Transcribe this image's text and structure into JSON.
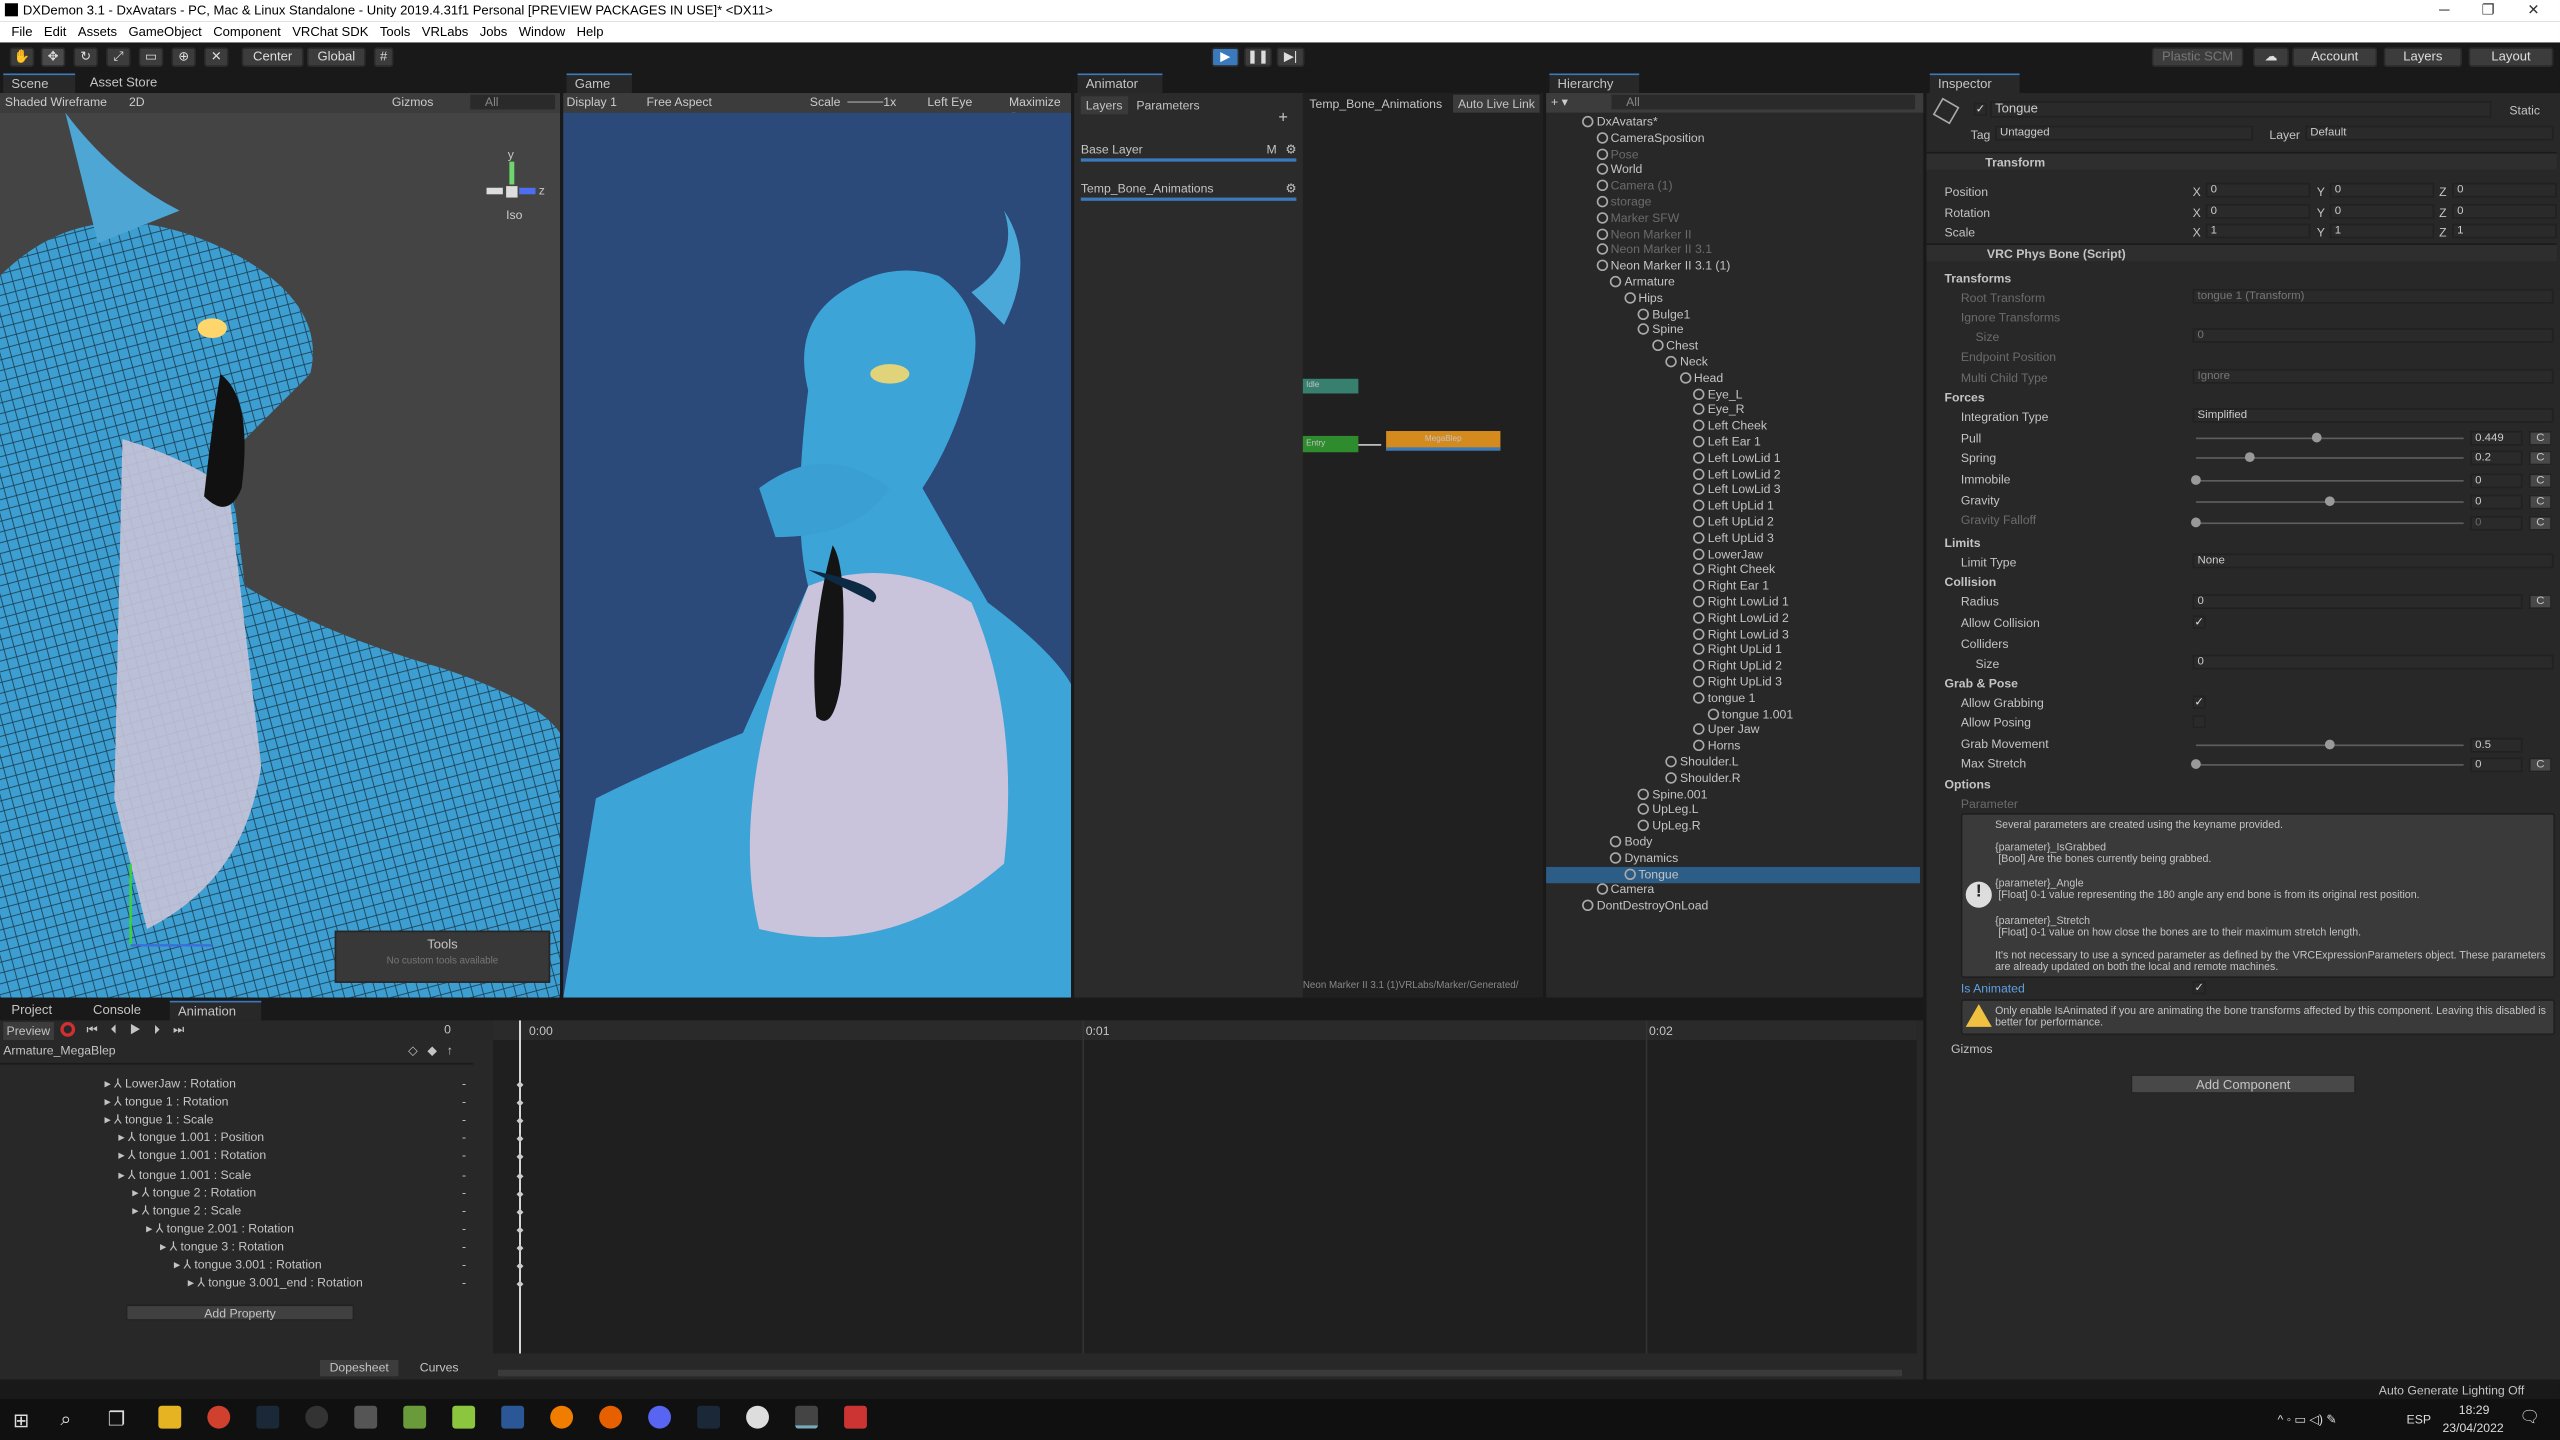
{
  "window": {
    "title": "DXDemon 3.1 - DxAvatars - PC, Mac & Linux Standalone - Unity 2019.4.31f1 Personal [PREVIEW PACKAGES IN USE]* <DX11>",
    "minimize": "─",
    "maximize": "❐",
    "close": "✕"
  },
  "menu": [
    "File",
    "Edit",
    "Assets",
    "GameObject",
    "Component",
    "VRChat SDK",
    "Tools",
    "VRLabs",
    "Jobs",
    "Window",
    "Help"
  ],
  "toolbar": {
    "center": "Center",
    "global": "Global",
    "plastic": "Plastic SCM",
    "account": "Account",
    "layers": "Layers",
    "layout": "Layout"
  },
  "scene": {
    "tab_scene": "Scene",
    "tab_asset_store": "Asset Store",
    "shading": "Shaded Wireframe",
    "mode2d": "2D",
    "gizmos": "Gizmos",
    "search": "All",
    "iso": "Iso",
    "tools_title": "Tools",
    "tools_msg": "No custom tools available",
    "persp_y": "y",
    "persp_z": "z"
  },
  "game": {
    "tab": "Game",
    "display": "Display 1",
    "aspect": "Free Aspect",
    "scale": "Scale",
    "scale_val": "1x",
    "eye": "Left Eye",
    "maximize": "Maximize O"
  },
  "animator": {
    "tab": "Animator",
    "layers": "Layers",
    "parameters": "Parameters",
    "breadcrumb": "Temp_Bone_Animations",
    "auto_live": "Auto Live Link",
    "base_layer": "Base Layer",
    "base_m": "M",
    "layer2": "Temp_Bone_Animations",
    "state_entry": "Entry",
    "state_idle": "Idle",
    "state_mega": "MegaBlep",
    "path": "Neon Marker II 3.1 (1)VRLabs/Marker/Generated/"
  },
  "hierarchy": {
    "tab": "Hierarchy",
    "search": "All",
    "items": [
      {
        "label": "DxAvatars*",
        "depth": 0,
        "dim": false,
        "sel": false
      },
      {
        "label": "CameraSposition",
        "depth": 1,
        "dim": false,
        "sel": false
      },
      {
        "label": "Pose",
        "depth": 1,
        "dim": true,
        "sel": false
      },
      {
        "label": "World",
        "depth": 1,
        "dim": false,
        "sel": false
      },
      {
        "label": "Camera (1)",
        "depth": 1,
        "dim": true,
        "sel": false
      },
      {
        "label": "storage",
        "depth": 1,
        "dim": true,
        "sel": false
      },
      {
        "label": "Marker SFW",
        "depth": 1,
        "dim": true,
        "sel": false
      },
      {
        "label": "Neon Marker II",
        "depth": 1,
        "dim": true,
        "sel": false
      },
      {
        "label": "Neon Marker II 3.1",
        "depth": 1,
        "dim": true,
        "sel": false
      },
      {
        "label": "Neon Marker II 3.1 (1)",
        "depth": 1,
        "dim": false,
        "sel": false
      },
      {
        "label": "Armature",
        "depth": 2,
        "dim": false,
        "sel": false
      },
      {
        "label": "Hips",
        "depth": 3,
        "dim": false,
        "sel": false
      },
      {
        "label": "Bulge1",
        "depth": 4,
        "dim": false,
        "sel": false
      },
      {
        "label": "Spine",
        "depth": 4,
        "dim": false,
        "sel": false
      },
      {
        "label": "Chest",
        "depth": 5,
        "dim": false,
        "sel": false
      },
      {
        "label": "Neck",
        "depth": 6,
        "dim": false,
        "sel": false
      },
      {
        "label": "Head",
        "depth": 7,
        "dim": false,
        "sel": false
      },
      {
        "label": "Eye_L",
        "depth": 8,
        "dim": false,
        "sel": false
      },
      {
        "label": "Eye_R",
        "depth": 8,
        "dim": false,
        "sel": false
      },
      {
        "label": "Left Cheek",
        "depth": 8,
        "dim": false,
        "sel": false
      },
      {
        "label": "Left Ear 1",
        "depth": 8,
        "dim": false,
        "sel": false
      },
      {
        "label": "Left LowLid 1",
        "depth": 8,
        "dim": false,
        "sel": false
      },
      {
        "label": "Left LowLid 2",
        "depth": 8,
        "dim": false,
        "sel": false
      },
      {
        "label": "Left LowLid 3",
        "depth": 8,
        "dim": false,
        "sel": false
      },
      {
        "label": "Left UpLid 1",
        "depth": 8,
        "dim": false,
        "sel": false
      },
      {
        "label": "Left UpLid 2",
        "depth": 8,
        "dim": false,
        "sel": false
      },
      {
        "label": "Left UpLid 3",
        "depth": 8,
        "dim": false,
        "sel": false
      },
      {
        "label": "LowerJaw",
        "depth": 8,
        "dim": false,
        "sel": false
      },
      {
        "label": "Right Cheek",
        "depth": 8,
        "dim": false,
        "sel": false
      },
      {
        "label": "Right Ear 1",
        "depth": 8,
        "dim": false,
        "sel": false
      },
      {
        "label": "Right LowLid 1",
        "depth": 8,
        "dim": false,
        "sel": false
      },
      {
        "label": "Right LowLid 2",
        "depth": 8,
        "dim": false,
        "sel": false
      },
      {
        "label": "Right LowLid 3",
        "depth": 8,
        "dim": false,
        "sel": false
      },
      {
        "label": "Right UpLid 1",
        "depth": 8,
        "dim": false,
        "sel": false
      },
      {
        "label": "Right UpLid 2",
        "depth": 8,
        "dim": false,
        "sel": false
      },
      {
        "label": "Right UpLid 3",
        "depth": 8,
        "dim": false,
        "sel": false
      },
      {
        "label": "tongue 1",
        "depth": 8,
        "dim": false,
        "sel": false
      },
      {
        "label": "tongue 1.001",
        "depth": 9,
        "dim": false,
        "sel": false
      },
      {
        "label": "Uper Jaw",
        "depth": 8,
        "dim": false,
        "sel": false
      },
      {
        "label": "Horns",
        "depth": 8,
        "dim": false,
        "sel": false
      },
      {
        "label": "Shoulder.L",
        "depth": 6,
        "dim": false,
        "sel": false
      },
      {
        "label": "Shoulder.R",
        "depth": 6,
        "dim": false,
        "sel": false
      },
      {
        "label": "Spine.001",
        "depth": 4,
        "dim": false,
        "sel": false
      },
      {
        "label": "UpLeg.L",
        "depth": 4,
        "dim": false,
        "sel": false
      },
      {
        "label": "UpLeg.R",
        "depth": 4,
        "dim": false,
        "sel": false
      },
      {
        "label": "Body",
        "depth": 2,
        "dim": false,
        "sel": false
      },
      {
        "label": "Dynamics",
        "depth": 2,
        "dim": false,
        "sel": false
      },
      {
        "label": "Tongue",
        "depth": 3,
        "dim": false,
        "sel": true
      },
      {
        "label": "Camera",
        "depth": 1,
        "dim": false,
        "sel": false
      },
      {
        "label": "DontDestroyOnLoad",
        "depth": 0,
        "dim": false,
        "sel": false
      }
    ]
  },
  "inspector": {
    "tab": "Inspector",
    "name": "Tongue",
    "static": "Static",
    "tag_label": "Tag",
    "tag": "Untagged",
    "layer_label": "Layer",
    "layer": "Default",
    "transform": "Transform",
    "position": "Position",
    "rotation": "Rotation",
    "scale": "Scale",
    "pos": {
      "x": "0",
      "y": "0",
      "z": "0"
    },
    "rot": {
      "x": "0",
      "y": "0",
      "z": "0"
    },
    "scl": {
      "x": "1",
      "y": "1",
      "z": "1"
    },
    "x": "X",
    "y": "Y",
    "z": "Z",
    "physbone": "VRC Phys Bone (Script)",
    "transforms": "Transforms",
    "root_transform": "Root Transform",
    "root_val": "tongue 1 (Transform)",
    "ignore_transforms": "Ignore Transforms",
    "size": "Size",
    "size_val": "0",
    "endpoint": "Endpoint Position",
    "multi_child": "Multi Child Type",
    "multi_val": "Ignore",
    "forces": "Forces",
    "integration": "Integration Type",
    "integration_val": "Simplified",
    "pull": "Pull",
    "pull_val": "0.449",
    "spring": "Spring",
    "spring_val": "0.2",
    "immobile": "Immobile",
    "immobile_val": "0",
    "gravity": "Gravity",
    "gravity_val": "0",
    "gravity_falloff": "Gravity Falloff",
    "gravity_falloff_val": "0",
    "c": "C",
    "limits": "Limits",
    "limit_type": "Limit Type",
    "limit_val": "None",
    "collision": "Collision",
    "radius": "Radius",
    "radius_val": "0",
    "allow_collision": "Allow Collision",
    "colliders": "Colliders",
    "colliders_size": "0",
    "grab_pose": "Grab & Pose",
    "allow_grabbing": "Allow Grabbing",
    "allow_posing": "Allow Posing",
    "grab_movement": "Grab Movement",
    "grab_movement_val": "0.5",
    "max_stretch": "Max Stretch",
    "max_stretch_val": "0",
    "options": "Options",
    "parameter": "Parameter",
    "help1": "Several parameters are created using the keyname provided.",
    "help2a": "{parameter}_IsGrabbed",
    "help2b": "[Bool] Are the bones currently being grabbed.",
    "help3a": "{parameter}_Angle",
    "help3b": "[Float] 0-1 value representing the 180 angle any end bone is from its original rest position.",
    "help4a": "{parameter}_Stretch",
    "help4b": "[Float] 0-1 value on how close the bones are to their maximum stretch length.",
    "help5": "It's not necessary to use a synced parameter as defined by the VRCExpressionParameters object.  These parameters are already updated on both the local and remote machines.",
    "is_animated": "Is Animated",
    "warn": "Only enable IsAnimated if you are animating the bone transforms affected by this component. Leaving this disabled is better for performance.",
    "gizmos": "Gizmos",
    "add_component": "Add Component"
  },
  "bottom": {
    "tab_project": "Project",
    "tab_console": "Console",
    "tab_animation": "Animation",
    "preview": "Preview",
    "frame": "0",
    "clip": "Armature_MegaBlep",
    "t0": "0:00",
    "t1": "0:01",
    "t2": "0:02",
    "add_property": "Add Property",
    "dopesheet": "Dopesheet",
    "curves": "Curves",
    "rows": [
      {
        "label": "LowerJaw : Rotation",
        "indent": 0
      },
      {
        "label": "tongue 1 : Rotation",
        "indent": 0
      },
      {
        "label": "tongue 1 : Scale",
        "indent": 0
      },
      {
        "label": "tongue 1.001 : Position",
        "indent": 1
      },
      {
        "label": "tongue 1.001 : Rotation",
        "indent": 1
      },
      {
        "label": "tongue 1.001 : Scale",
        "indent": 1
      },
      {
        "label": "tongue 2 : Rotation",
        "indent": 2
      },
      {
        "label": "tongue 2 : Scale",
        "indent": 2
      },
      {
        "label": "tongue 2.001 : Rotation",
        "indent": 3
      },
      {
        "label": "tongue 3 : Rotation",
        "indent": 4
      },
      {
        "label": "tongue 3.001 : Rotation",
        "indent": 5
      },
      {
        "label": "tongue 3.001_end : Rotation",
        "indent": 6
      }
    ]
  },
  "status": {
    "lighting": "Auto Generate Lighting Off"
  },
  "taskbar": {
    "lang": "ESP",
    "time": "18:29",
    "date": "23/04/2022"
  },
  "colors": {
    "accent": "#3a79bb",
    "scene_bg": "#3c3c3c",
    "game_bg": "#2b4a7a",
    "dragon": "#3d9fd1",
    "select": "#2c5d87",
    "warn": "#f0c040",
    "state_mega": "#d58a1e",
    "state_entry": "#2e8b2e"
  }
}
